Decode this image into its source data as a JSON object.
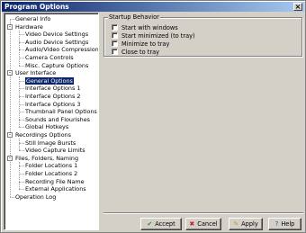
{
  "window": {
    "title": "Program Options"
  },
  "tree": {
    "items": [
      {
        "label": "General Info",
        "level": 0
      },
      {
        "label": "Hardware",
        "level": 0,
        "expander": "-"
      },
      {
        "label": "Video Device Settings",
        "level": 1
      },
      {
        "label": "Audio Device Settings",
        "level": 1
      },
      {
        "label": "Audio/Video Compression",
        "level": 1
      },
      {
        "label": "Camera Controls",
        "level": 1
      },
      {
        "label": "Misc. Capture Options",
        "level": 1
      },
      {
        "label": "User Interface",
        "level": 0,
        "expander": "-"
      },
      {
        "label": "General Options",
        "level": 1,
        "selected": true
      },
      {
        "label": "Interface Options 1",
        "level": 1
      },
      {
        "label": "Interface Options 2",
        "level": 1
      },
      {
        "label": "Interface Options 3",
        "level": 1
      },
      {
        "label": "Thumbnail Panel Options",
        "level": 1
      },
      {
        "label": "Sounds and Flourishes",
        "level": 1
      },
      {
        "label": "Global Hotkeys",
        "level": 1
      },
      {
        "label": "Recordings Options",
        "level": 0,
        "expander": "-"
      },
      {
        "label": "Still Image Bursts",
        "level": 1
      },
      {
        "label": "Video Capture Limits",
        "level": 1
      },
      {
        "label": "Files, Folders, Naming",
        "level": 0,
        "expander": "-"
      },
      {
        "label": "Folder Locations 1",
        "level": 1
      },
      {
        "label": "Folder Locations 2",
        "level": 1
      },
      {
        "label": "Recording File Name",
        "level": 1
      },
      {
        "label": "External Applications",
        "level": 1
      },
      {
        "label": "Operation Log",
        "level": 0
      }
    ]
  },
  "startup": {
    "legend": "Startup Behavior",
    "options": [
      {
        "label": "Start with windows",
        "checked": false
      },
      {
        "label": "Start minimized (to tray)",
        "checked": false
      },
      {
        "label": "Minimize to tray",
        "checked": false
      },
      {
        "label": "Close to tray",
        "checked": false
      }
    ]
  },
  "buttons": {
    "accept": {
      "label": "Accept",
      "icon": "checkmark-icon",
      "color": "#2e8b2e"
    },
    "cancel": {
      "label": "Cancel",
      "icon": "x-icon",
      "color": "#c0202a"
    },
    "apply": {
      "label": "Apply",
      "icon": "pencil-icon",
      "color": "#b0a020"
    },
    "help": {
      "label": "Help",
      "icon": "help-icon",
      "color": "#205aa0"
    }
  },
  "colors": {
    "titlebar_start": "#0a246a",
    "titlebar_end": "#a6caf0",
    "selection": "#0a246a",
    "face": "#d4d0c8"
  }
}
